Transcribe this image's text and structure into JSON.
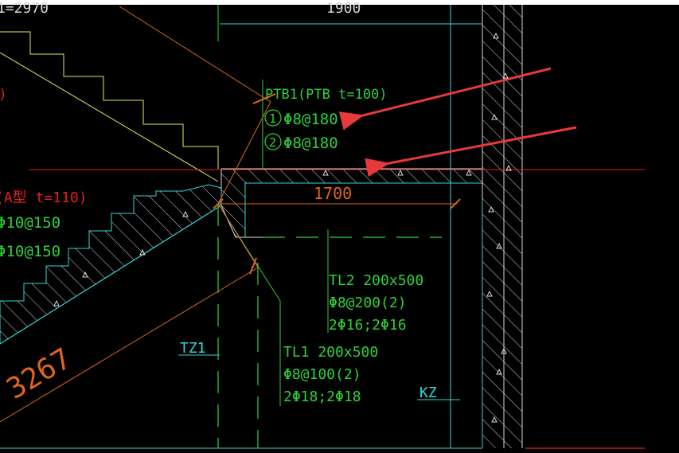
{
  "colors": {
    "background": "#000000",
    "stair_outline": "#e8e85a",
    "concrete": "#d8d8d8",
    "cyan": "#33d6d6",
    "green": "#2fd13a",
    "orange": "#e0641e",
    "red": "#e02020",
    "arrow": "#e83a3a",
    "white": "#ffffff"
  },
  "dimensions": {
    "top_left_partial": "1=2970",
    "top_span": "1900",
    "landing_span": "1700",
    "flight_length": "3267"
  },
  "slab_callout": {
    "title": "PTB1(PTB t=100)",
    "rebar_1_marker": "1",
    "rebar_1": "Φ8@180",
    "rebar_2_marker": "2",
    "rebar_2": "Φ8@180"
  },
  "stair_callout": {
    "title_partial": "(A型 t=110)",
    "rebar_1": "Φ10@150",
    "rebar_2": "Φ10@150",
    "paren_partial": ")"
  },
  "beam_tl2": {
    "title": "TL2 200x500",
    "stirrup": "Φ8@200(2)",
    "main_bars": "2Φ16;2Φ16"
  },
  "beam_tl1": {
    "title": "TL1 200x500",
    "stirrup": "Φ8@100(2)",
    "main_bars": "2Φ18;2Φ18"
  },
  "column_labels": {
    "tz1": "TZ1",
    "kz": "KZ"
  }
}
